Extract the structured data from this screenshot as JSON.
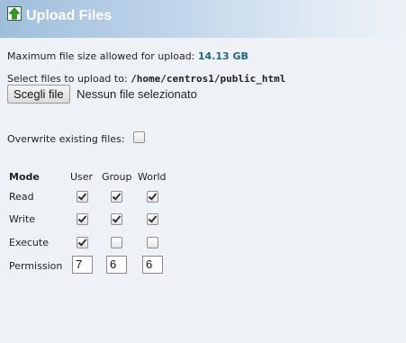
{
  "header": {
    "title": "Upload Files",
    "icon": "green-up-arrow-icon"
  },
  "max_size": {
    "label": "Maximum file size allowed for upload:",
    "value": "14.13 GB"
  },
  "destination": {
    "label": "Select files to upload to:",
    "path": "/home/centros1/public_html"
  },
  "file_picker": {
    "button_label": "Scegli file",
    "status": "Nessun file selezionato"
  },
  "overwrite": {
    "label": "Overwrite existing files:",
    "checked": false
  },
  "permissions": {
    "headers": {
      "mode": "Mode",
      "user": "User",
      "group": "Group",
      "world": "World"
    },
    "rows": [
      {
        "label": "Read",
        "user": true,
        "group": true,
        "world": true
      },
      {
        "label": "Write",
        "user": true,
        "group": true,
        "world": true
      },
      {
        "label": "Execute",
        "user": true,
        "group": false,
        "world": false
      }
    ],
    "permission_label": "Permission",
    "values": {
      "user": "7",
      "group": "6",
      "world": "6"
    }
  }
}
